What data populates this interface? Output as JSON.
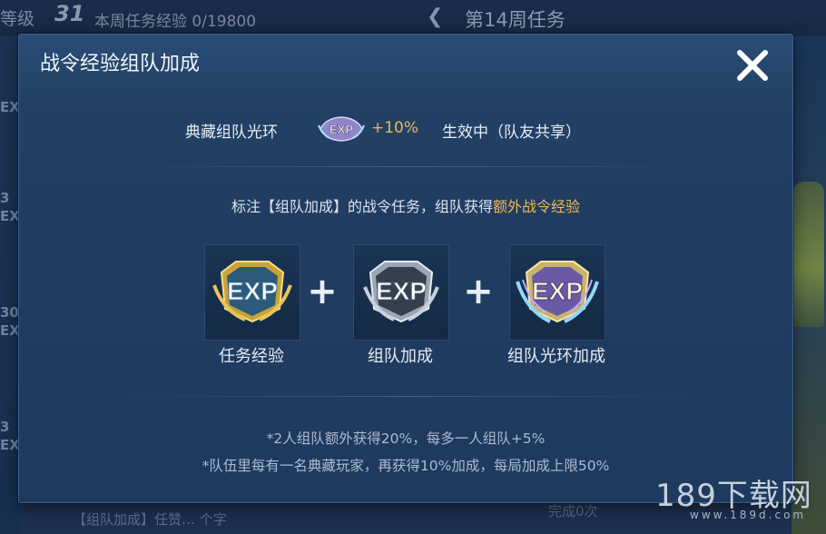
{
  "background": {
    "level_label": "等级",
    "level_number": "31",
    "weekly_exp": "本周任务经验 0/19800",
    "week_title": "第14周任务",
    "side_items": [
      "EX",
      "3",
      "EX",
      "30",
      "EX",
      "3",
      "EX"
    ],
    "bottom_text": "【组队加成】任赞…  个字",
    "done_text": "完成0次"
  },
  "modal": {
    "title": "战令经验组队加成",
    "aura": {
      "label": "典藏组队光环",
      "badge_icon": "exp-aura-badge-icon",
      "percent": "+10%",
      "status": "生效中（队友共享）"
    },
    "description_prefix": "标注【组队加成】的战令任务，组队获得",
    "description_highlight": "额外战令经验",
    "cards": [
      {
        "label": "任务经验",
        "icon": "exp-gold-icon"
      },
      {
        "label": "组队加成",
        "icon": "exp-silver-icon"
      },
      {
        "label": "组队光环加成",
        "icon": "exp-aura-icon"
      }
    ],
    "plus_sign": "+",
    "notes": [
      "*2人组队额外获得20%，每多一人组队+5%",
      "*队伍里每有一名典藏玩家，再获得10%加成，每局加成上限50%"
    ]
  },
  "watermark": {
    "main": "189下载网",
    "sub": "www.189d.com"
  },
  "colors": {
    "accent": "#f0b94d",
    "modal_bg": "#203c60",
    "text": "#e8edf5"
  }
}
